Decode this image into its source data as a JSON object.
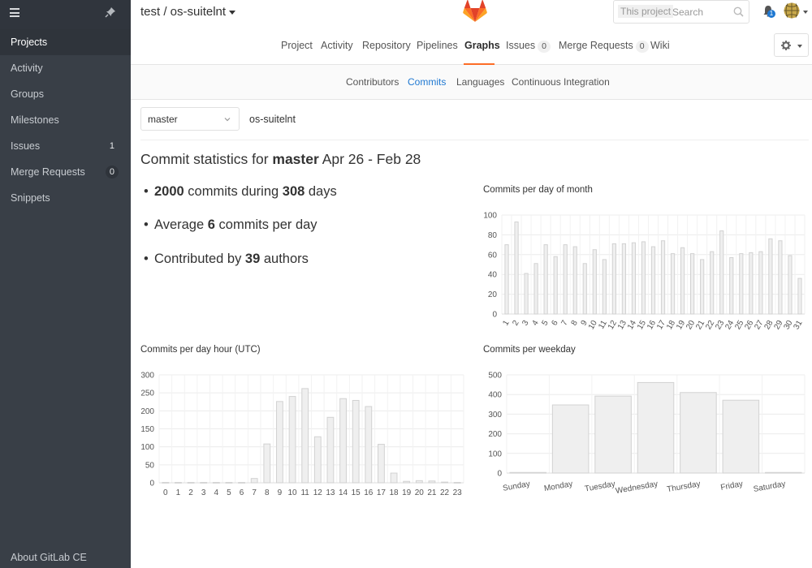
{
  "sidebar": {
    "items": [
      {
        "label": "Projects",
        "active": true
      },
      {
        "label": "Activity"
      },
      {
        "label": "Groups"
      },
      {
        "label": "Milestones"
      },
      {
        "label": "Issues",
        "count": "1"
      },
      {
        "label": "Merge Requests",
        "count": "0"
      },
      {
        "label": "Snippets"
      }
    ],
    "about": "About GitLab CE"
  },
  "header": {
    "project": "test / os-suitelnt",
    "search_scope": "This project",
    "search_placeholder": "Search",
    "notifications": "1",
    "brand_color": "#fc6d26"
  },
  "tabs": [
    {
      "label": "Project"
    },
    {
      "label": "Activity"
    },
    {
      "label": "Repository"
    },
    {
      "label": "Pipelines"
    },
    {
      "label": "Graphs",
      "active": true
    },
    {
      "label": "Issues",
      "count": "0"
    },
    {
      "label": "Merge Requests",
      "count": "0"
    },
    {
      "label": "Wiki"
    }
  ],
  "subtabs": [
    {
      "label": "Contributors"
    },
    {
      "label": "Commits",
      "active": true
    },
    {
      "label": "Languages"
    },
    {
      "label": "Continuous Integration"
    }
  ],
  "branch": "master",
  "project_path": "os-suitelnt",
  "stats": {
    "title_prefix": "Commit statistics for ",
    "branch": "master",
    "range": " Apr 26 - Feb 28",
    "commits": "2000",
    "commits_mid": " commits during ",
    "days": "308",
    "days_suffix": " days",
    "avg_prefix": "Average ",
    "avg": "6",
    "avg_suffix": " commits per day",
    "contrib_prefix": "Contributed by ",
    "authors": "39",
    "authors_suffix": " authors"
  },
  "chart_data": [
    {
      "type": "bar",
      "title": "Commits per day of month",
      "categories": [
        "1",
        "2",
        "3",
        "4",
        "5",
        "6",
        "7",
        "8",
        "9",
        "10",
        "11",
        "12",
        "13",
        "14",
        "15",
        "16",
        "17",
        "18",
        "19",
        "20",
        "21",
        "22",
        "23",
        "24",
        "25",
        "26",
        "27",
        "28",
        "29",
        "30",
        "31"
      ],
      "values": [
        70,
        93,
        41,
        51,
        70,
        58,
        70,
        68,
        51,
        65,
        55,
        71,
        71,
        72,
        73,
        68,
        74,
        61,
        67,
        61,
        55,
        63,
        84,
        57,
        61,
        62,
        63,
        76,
        74,
        59,
        36
      ],
      "ylim": [
        0,
        100
      ],
      "yticks": [
        0,
        20,
        40,
        60,
        80,
        100
      ],
      "grid": true
    },
    {
      "type": "bar",
      "title": "Commits per day hour (UTC)",
      "categories": [
        "0",
        "1",
        "2",
        "3",
        "4",
        "5",
        "6",
        "7",
        "8",
        "9",
        "10",
        "11",
        "12",
        "13",
        "14",
        "15",
        "16",
        "17",
        "18",
        "19",
        "20",
        "21",
        "22",
        "23"
      ],
      "values": [
        1,
        1,
        1,
        1,
        1,
        1,
        1,
        12,
        108,
        226,
        240,
        262,
        128,
        182,
        234,
        229,
        212,
        107,
        27,
        4,
        6,
        5,
        2,
        1
      ],
      "ylim": [
        0,
        300
      ],
      "yticks": [
        0,
        50,
        100,
        150,
        200,
        250,
        300
      ],
      "grid": true
    },
    {
      "type": "bar",
      "title": "Commits per weekday",
      "categories": [
        "Sunday",
        "Monday",
        "Tuesday",
        "Wednesday",
        "Thursday",
        "Friday",
        "Saturday"
      ],
      "values": [
        3,
        347,
        392,
        461,
        410,
        371,
        3
      ],
      "ylim": [
        0,
        500
      ],
      "yticks": [
        0,
        100,
        200,
        300,
        400,
        500
      ],
      "grid": true
    }
  ]
}
